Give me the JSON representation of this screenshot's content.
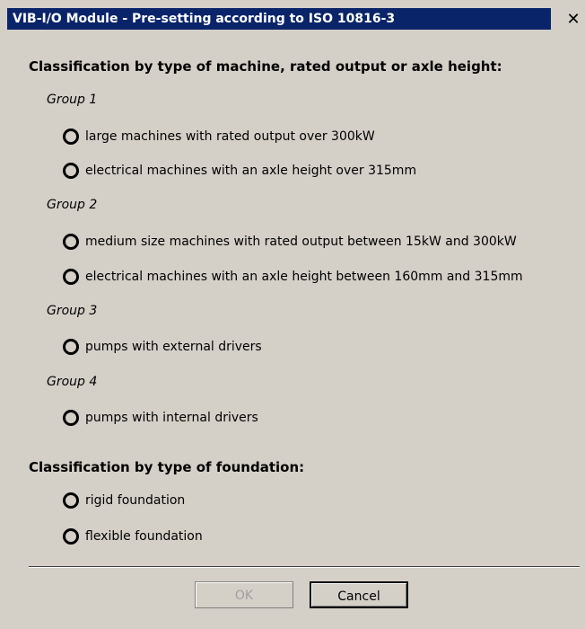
{
  "window": {
    "title": "VIB-I/O Module - Pre-setting according to ISO 10816-3",
    "close_glyph": "✕"
  },
  "machine_section": {
    "heading": "Classification by type of machine, rated output or axle height:",
    "groups": [
      {
        "label": "Group 1",
        "options": [
          "large machines with rated output over 300kW",
          "electrical machines with an axle height over 315mm"
        ]
      },
      {
        "label": "Group 2",
        "options": [
          "medium size machines with rated output between 15kW and 300kW",
          "electrical machines with an axle height between 160mm and 315mm"
        ]
      },
      {
        "label": "Group 3",
        "options": [
          "pumps with external drivers"
        ]
      },
      {
        "label": "Group 4",
        "options": [
          "pumps with internal drivers"
        ]
      }
    ]
  },
  "foundation_section": {
    "heading": "Classification by type of foundation:",
    "options": [
      "rigid foundation",
      "flexible foundation"
    ]
  },
  "buttons": {
    "ok_label": "OK",
    "ok_enabled": false,
    "cancel_label": "Cancel"
  }
}
